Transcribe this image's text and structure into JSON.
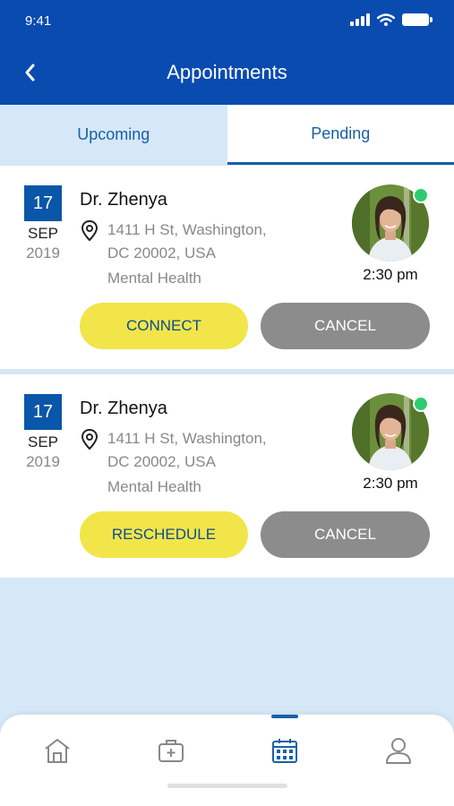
{
  "status_bar": {
    "time": "9:41"
  },
  "header": {
    "title": "Appointments"
  },
  "tabs": [
    {
      "label": "Upcoming",
      "active": false
    },
    {
      "label": "Pending",
      "active": true
    }
  ],
  "appointments": [
    {
      "day": "17",
      "month": "SEP",
      "year": "2019",
      "doctor": "Dr. Zhenya",
      "address_line1": "1411 H St, Washington,",
      "address_line2": "DC 20002, USA",
      "specialty": "Mental Health",
      "time": "2:30 pm",
      "primary_action": "CONNECT",
      "cancel_action": "CANCEL",
      "online": true
    },
    {
      "day": "17",
      "month": "SEP",
      "year": "2019",
      "doctor": "Dr. Zhenya",
      "address_line1": "1411 H St, Washington,",
      "address_line2": "DC 20002, USA",
      "specialty": "Mental Health",
      "time": "2:30 pm",
      "primary_action": "RESCHEDULE",
      "cancel_action": "CANCEL",
      "online": true
    }
  ],
  "bottom_nav": [
    {
      "icon": "home-icon",
      "active": false
    },
    {
      "icon": "medical-kit-icon",
      "active": false
    },
    {
      "icon": "calendar-icon",
      "active": true
    },
    {
      "icon": "user-icon",
      "active": false
    }
  ],
  "colors": {
    "header_bg": "#0a4bb0",
    "accent": "#1760a8",
    "primary_button": "#f1e54a",
    "cancel_button": "#8c8c8c",
    "online": "#2ecc71",
    "background": "#d6e8f7"
  }
}
